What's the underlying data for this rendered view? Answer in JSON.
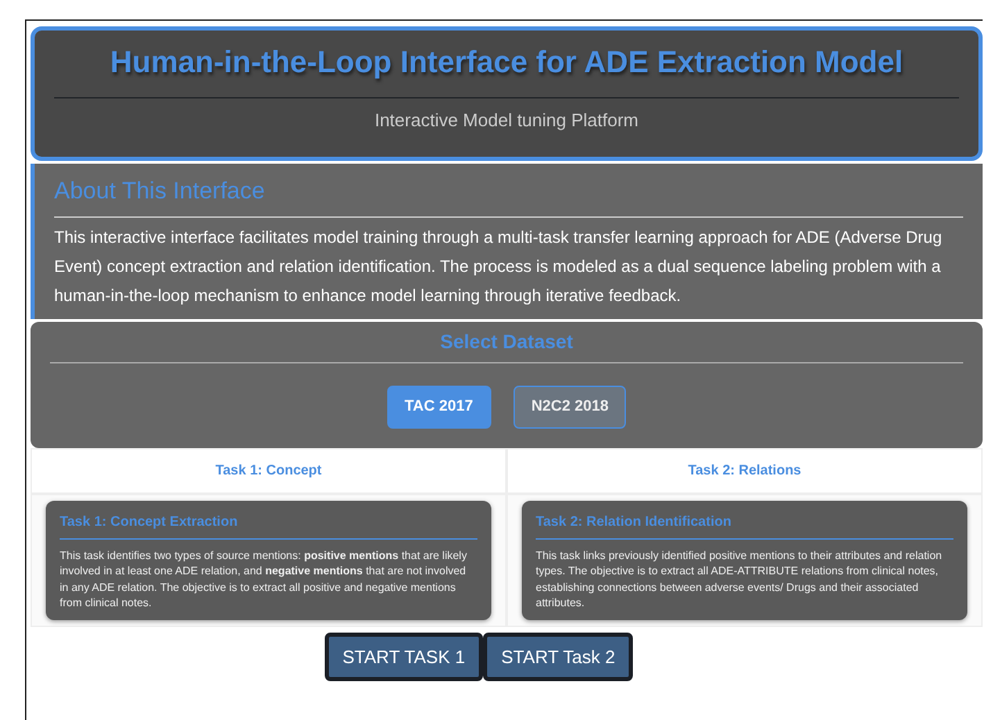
{
  "header": {
    "title": "Human-in-the-Loop Interface for ADE Extraction Model",
    "subtitle": "Interactive Model tuning Platform"
  },
  "about": {
    "title": "About This Interface",
    "text": "This interactive interface facilitates model training through a multi-task transfer learning approach for ADE (Adverse Drug Event) concept extraction and relation identification. The process is modeled as a dual sequence labeling problem with a human-in-the-loop mechanism to enhance model learning through iterative feedback."
  },
  "dataset": {
    "title": "Select Dataset",
    "options": [
      {
        "label": "TAC 2017",
        "selected": true
      },
      {
        "label": "N2C2 2018",
        "selected": false
      }
    ]
  },
  "tasks": [
    {
      "tab": "Task 1: Concept",
      "title": "Task 1: Concept Extraction",
      "text": "This task identifies two types of source mentions: **positive mentions** that are likely involved in at least one ADE relation, and **negative mentions** that are not involved in any ADE relation. The objective is to extract all positive and negative mentions from clinical notes."
    },
    {
      "tab": "Task 2: Relations",
      "title": "Task 2: Relation Identification",
      "text": "This task links previously identified positive mentions to their attributes and relation types. The objective is to extract all ADE-ATTRIBUTE relations from clinical notes, establishing connections between adverse events/ Drugs and their associated attributes."
    }
  ],
  "buttons": [
    "START TASK 1",
    "START Task 2"
  ]
}
